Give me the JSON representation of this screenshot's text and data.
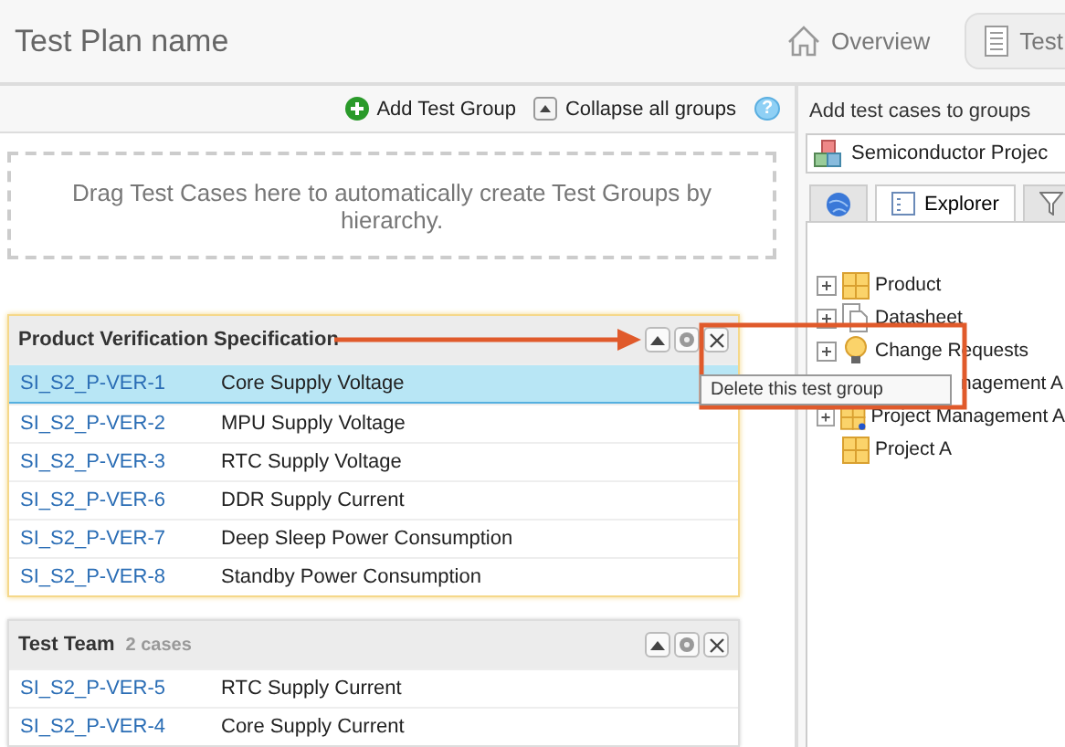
{
  "header": {
    "title": "Test Plan name",
    "tabs": [
      {
        "label": "Overview",
        "kind": "house",
        "selected": false
      },
      {
        "label": "Test",
        "kind": "list",
        "selected": true
      }
    ]
  },
  "toolbar": {
    "add_button": "Add Test Group",
    "collapse_button": "Collapse all groups",
    "help": "?"
  },
  "drop_zone": {
    "text": "Drag Test Cases here to automatically create Test Groups by hierarchy."
  },
  "groups": [
    {
      "name": "Product Verification Specification",
      "highlighted": true,
      "rows": [
        {
          "id": "SI_S2_P-VER-1",
          "title": "Core Supply Voltage",
          "selected": true
        },
        {
          "id": "SI_S2_P-VER-2",
          "title": "MPU Supply Voltage",
          "selected": false
        },
        {
          "id": "SI_S2_P-VER-3",
          "title": "RTC Supply Voltage",
          "selected": false
        },
        {
          "id": "SI_S2_P-VER-6",
          "title": "DDR Supply Current",
          "selected": false
        },
        {
          "id": "SI_S2_P-VER-7",
          "title": "Deep Sleep Power Consumption",
          "selected": false
        },
        {
          "id": "SI_S2_P-VER-8",
          "title": "Standby Power Consumption",
          "selected": false
        }
      ]
    },
    {
      "name": "Test Team",
      "count": "2 cases",
      "highlighted": false,
      "rows": [
        {
          "id": "SI_S2_P-VER-5",
          "title": "RTC Supply Current",
          "selected": false
        },
        {
          "id": "SI_S2_P-VER-4",
          "title": "Core Supply Current",
          "selected": false
        }
      ]
    }
  ],
  "tooltip": "Delete this test group",
  "side_panel": {
    "heading": "Add test cases to groups",
    "project": "Semiconductor Projec",
    "tabs": [
      {
        "kind": "globe",
        "selected": false
      },
      {
        "kind": "explorer",
        "label": "Explorer",
        "selected": true
      },
      {
        "kind": "filter",
        "selected": false
      }
    ],
    "tree": [
      {
        "label": "Product",
        "kind": "grid",
        "expandable": true
      },
      {
        "label": "Datasheet",
        "kind": "documents",
        "expandable": true
      },
      {
        "label": "Change Requests",
        "kind": "bulb",
        "expandable": true
      },
      {
        "label": "nagement A",
        "kind": "covered"
      },
      {
        "label": "Project Management A",
        "kind": "grid-dot",
        "expandable": true
      },
      {
        "label": "Project A",
        "kind": "grid",
        "expandable": false
      }
    ]
  }
}
